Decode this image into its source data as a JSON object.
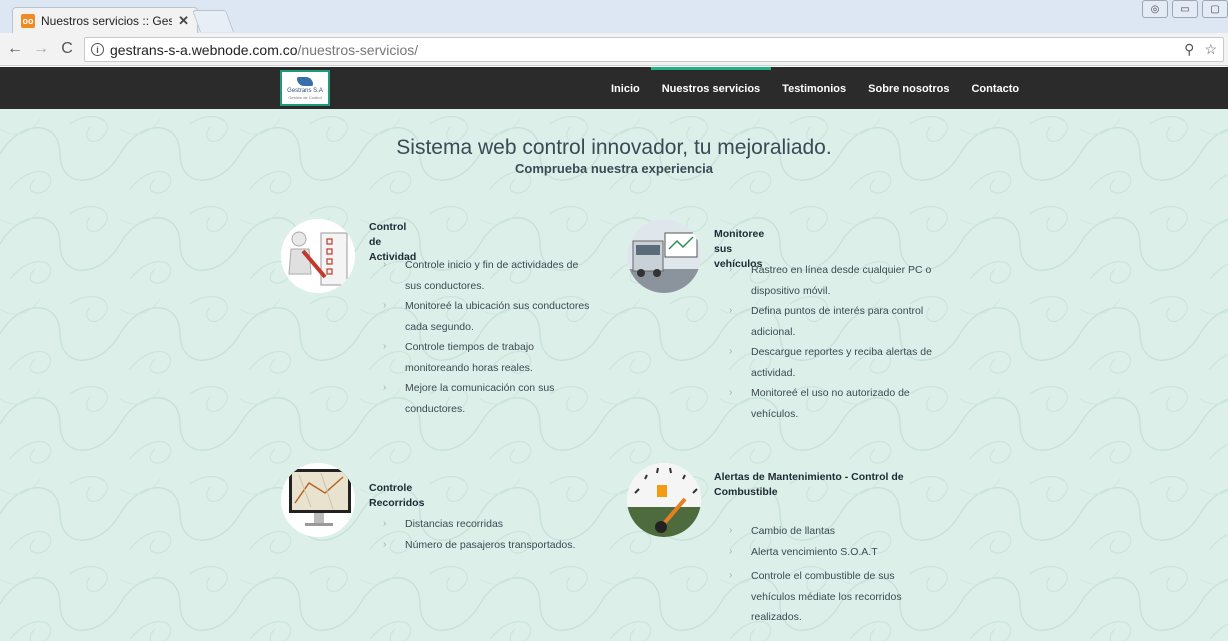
{
  "browser": {
    "tab_title": "Nuestros servicios :: Gest",
    "tab_close": "✕",
    "favicon": "oo",
    "url_host": "gestrans-s-a.webnode.com.co",
    "url_path": "/nuestros-servicios/",
    "icons": [
      "back-arrow-icon",
      "forward-arrow-icon",
      "reload-icon",
      "info-icon",
      "zoom-icon",
      "star-icon"
    ]
  },
  "site": {
    "logo": {
      "name": "Gestrans S.A",
      "tagline": "Gestión de Control"
    },
    "nav": [
      "Inicio",
      "Nuestros servicios",
      "Testimonios",
      "Sobre nosotros",
      "Contacto"
    ],
    "active_nav": "Nuestros servicios",
    "accent_color": "#1fb38a"
  },
  "hero": {
    "title": "Sistema web control innovador, tu mejoraliado.",
    "subtitle": "Comprueba nuestra experiencia"
  },
  "services": [
    {
      "title": "Control de Actividad",
      "items": [
        "Controle inicio y fin de actividades de",
        "sus conductores.",
        "Monitoreé la ubicación sus conductores",
        "cada segundo.",
        "Controle tiempos de trabajo",
        "monitoreando horas reales.",
        "Mejore la comunicación con sus",
        "conductores."
      ]
    },
    {
      "title": "Monitoree sus vehículos",
      "items": [
        "Rastreo en línea desde cualquier PC o",
        "dispositivo móvil.",
        "Defina puntos de interés para control",
        "adicional.",
        "Descargue reportes y reciba alertas de",
        "actividad.",
        "Monitoreé el uso no autorizado de",
        "vehículos."
      ]
    },
    {
      "title": "Controle Recorridos",
      "items": [
        "Distancias recorridas",
        "Número de pasajeros transportados."
      ]
    },
    {
      "title_line1": "Alertas de Mantenimiento - Control de",
      "title_line2": "Combustible",
      "items": [
        "Cambio de llantas",
        "Alerta vencimiento S.O.A.T",
        "Controle el combustible de sus",
        "vehículos médiate los recorridos",
        "realizados."
      ]
    }
  ]
}
